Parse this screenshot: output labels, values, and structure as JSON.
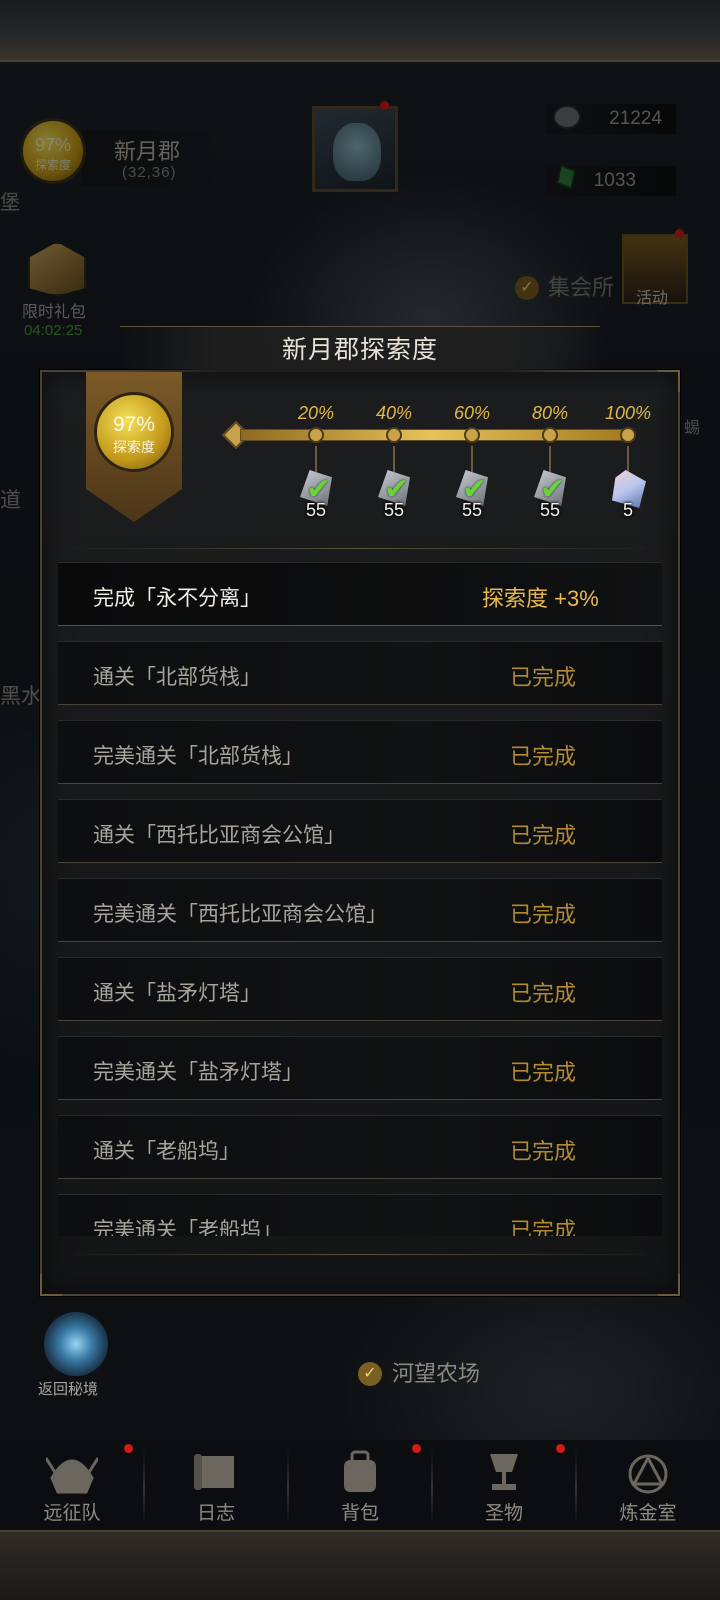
{
  "hud": {
    "exploration_percent": "97%",
    "exploration_label": "探索度",
    "region_name": "新月郡",
    "region_coords": "(32,36)",
    "left_edge_text": "堡",
    "resources": [
      {
        "icon": "silver-coin-icon",
        "value": "21224"
      },
      {
        "icon": "green-gem-icon",
        "value": "1033"
      }
    ],
    "gift_label": "限时礼包",
    "gift_timer": "04:02:25",
    "meeting_hall_label": "集会所",
    "event_label": "活动",
    "side_labels": [
      "道",
      "黑水",
      "蜴"
    ],
    "portal_label": "返回秘境",
    "farm_label": "河望农场"
  },
  "dialog": {
    "title": "新月郡探索度",
    "percent": "97%",
    "percent_label": "探索度",
    "progress": 0.97,
    "milestones": [
      {
        "label": "20%",
        "reward_icon": "ore-icon",
        "count": "55",
        "claimed": true
      },
      {
        "label": "40%",
        "reward_icon": "ore-icon",
        "count": "55",
        "claimed": true
      },
      {
        "label": "60%",
        "reward_icon": "ore-icon",
        "count": "55",
        "claimed": true
      },
      {
        "label": "80%",
        "reward_icon": "ore-icon",
        "count": "55",
        "claimed": true
      },
      {
        "label": "100%",
        "reward_icon": "crystal-icon",
        "count": "5",
        "claimed": false
      }
    ],
    "tasks": [
      {
        "task": "完成「永不分离」",
        "status": "探索度 +3%",
        "active": true
      },
      {
        "task": "通关「北部货栈」",
        "status": "已完成",
        "active": false
      },
      {
        "task": "完美通关「北部货栈」",
        "status": "已完成",
        "active": false
      },
      {
        "task": "通关「西托比亚商会公馆」",
        "status": "已完成",
        "active": false
      },
      {
        "task": "完美通关「西托比亚商会公馆」",
        "status": "已完成",
        "active": false
      },
      {
        "task": "通关「盐矛灯塔」",
        "status": "已完成",
        "active": false
      },
      {
        "task": "完美通关「盐矛灯塔」",
        "status": "已完成",
        "active": false
      },
      {
        "task": "通关「老船坞」",
        "status": "已完成",
        "active": false
      },
      {
        "task": "完美通关「老船坞」",
        "status": "已完成",
        "active": false
      }
    ]
  },
  "nav": [
    {
      "label": "远征队",
      "icon": "helmet-icon",
      "badge": true
    },
    {
      "label": "日志",
      "icon": "scroll-icon",
      "badge": false
    },
    {
      "label": "背包",
      "icon": "backpack-icon",
      "badge": true
    },
    {
      "label": "圣物",
      "icon": "chalice-icon",
      "badge": true
    },
    {
      "label": "炼金室",
      "icon": "alchemy-icon",
      "badge": false
    }
  ],
  "colors": {
    "gold": "#e1b84a",
    "status_done": "#b28a33",
    "timer_green": "#3da23a",
    "badge_red": "#d11c1c"
  }
}
